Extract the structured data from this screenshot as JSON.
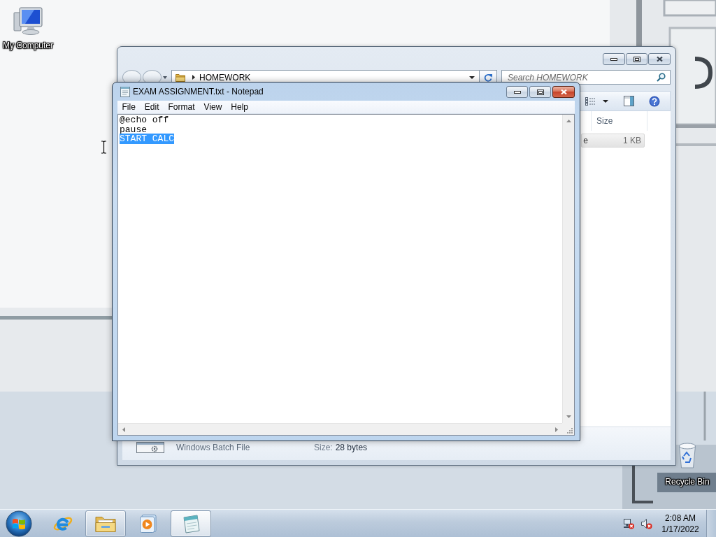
{
  "desktop": {
    "icons": [
      {
        "label": "My Computer",
        "kind": "computer"
      },
      {
        "label": "Recycle Bin",
        "kind": "recycle_bin"
      }
    ]
  },
  "explorer": {
    "active": false,
    "address": "HOMEWORK",
    "search": {
      "placeholder": "Search HOMEWORK"
    },
    "columns": [
      "Size"
    ],
    "rows": [
      {
        "column_1": "e",
        "size": "1 KB",
        "selected": true
      }
    ],
    "details": {
      "type": "Windows Batch File",
      "size_label": "Size:",
      "size": "28 bytes"
    }
  },
  "notepad": {
    "active": true,
    "title": "EXAM ASSIGNMENT.txt - Notepad",
    "menu": [
      "File",
      "Edit",
      "Format",
      "View",
      "Help"
    ],
    "lines": [
      {
        "text": "@echo off",
        "selected": false
      },
      {
        "text": "pause",
        "selected": false
      },
      {
        "text": "START CALC",
        "selected": true
      }
    ]
  },
  "taskbar": {
    "apps": [
      {
        "kind": "browser",
        "running": false,
        "active": false
      },
      {
        "kind": "explorer",
        "running": true,
        "active": false
      },
      {
        "kind": "media_player",
        "running": false,
        "active": false
      },
      {
        "kind": "notepad",
        "running": true,
        "active": true
      }
    ],
    "tray": {
      "network": {
        "connected": false
      },
      "volume": {
        "muted": true
      },
      "time": "2:08 AM",
      "date": "1/17/2022"
    }
  }
}
